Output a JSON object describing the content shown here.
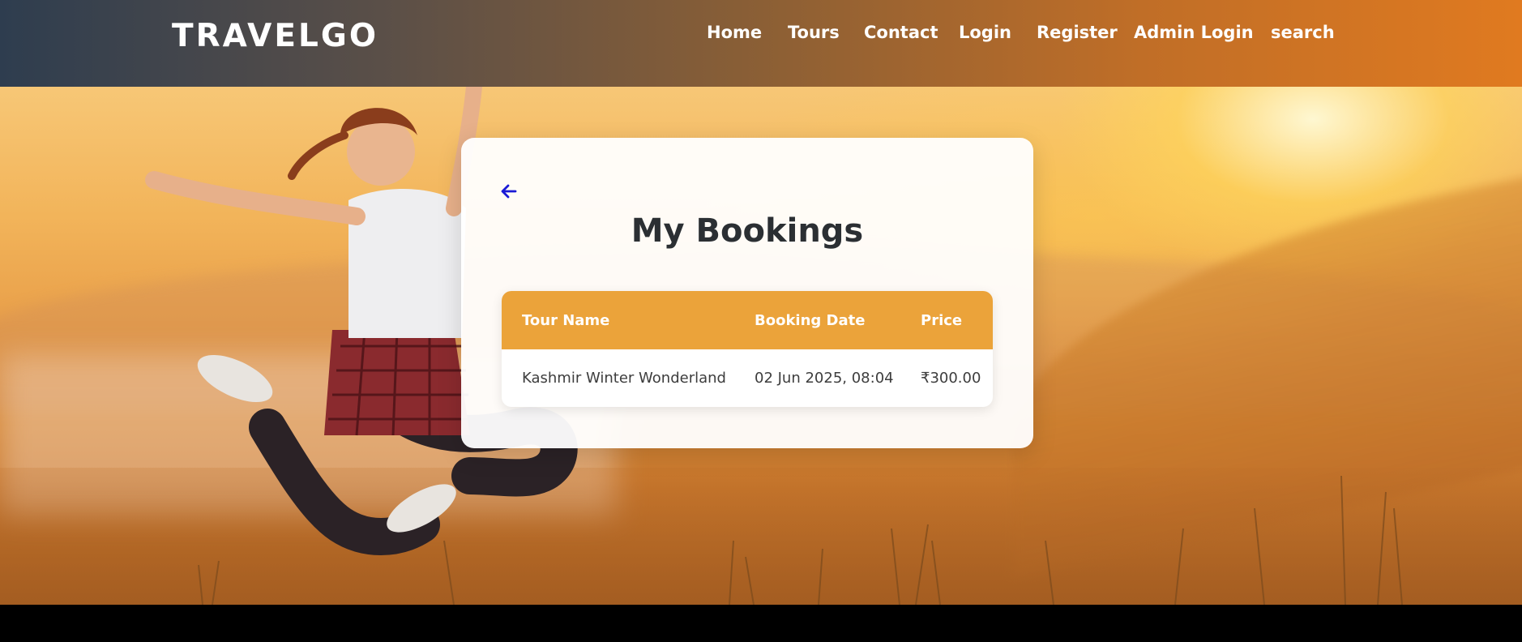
{
  "header": {
    "logo": "TRAVELGO",
    "nav": {
      "home": "Home",
      "tours": "Tours",
      "contact": "Contact",
      "login": "Login",
      "register": "Register",
      "admin_login": "Admin Login",
      "search": "search"
    }
  },
  "card": {
    "title": "My Bookings",
    "back_icon": "arrow-left-icon",
    "table": {
      "headers": [
        "Tour Name",
        "Booking Date",
        "Price"
      ],
      "rows": [
        [
          "Kashmir Winter Wonderland",
          "02 Jun 2025, 08:04",
          "₹300.00"
        ]
      ]
    }
  },
  "colors": {
    "accent": "#eba33a",
    "back_arrow": "#1a1ad6",
    "title_text": "#2b2f33"
  }
}
